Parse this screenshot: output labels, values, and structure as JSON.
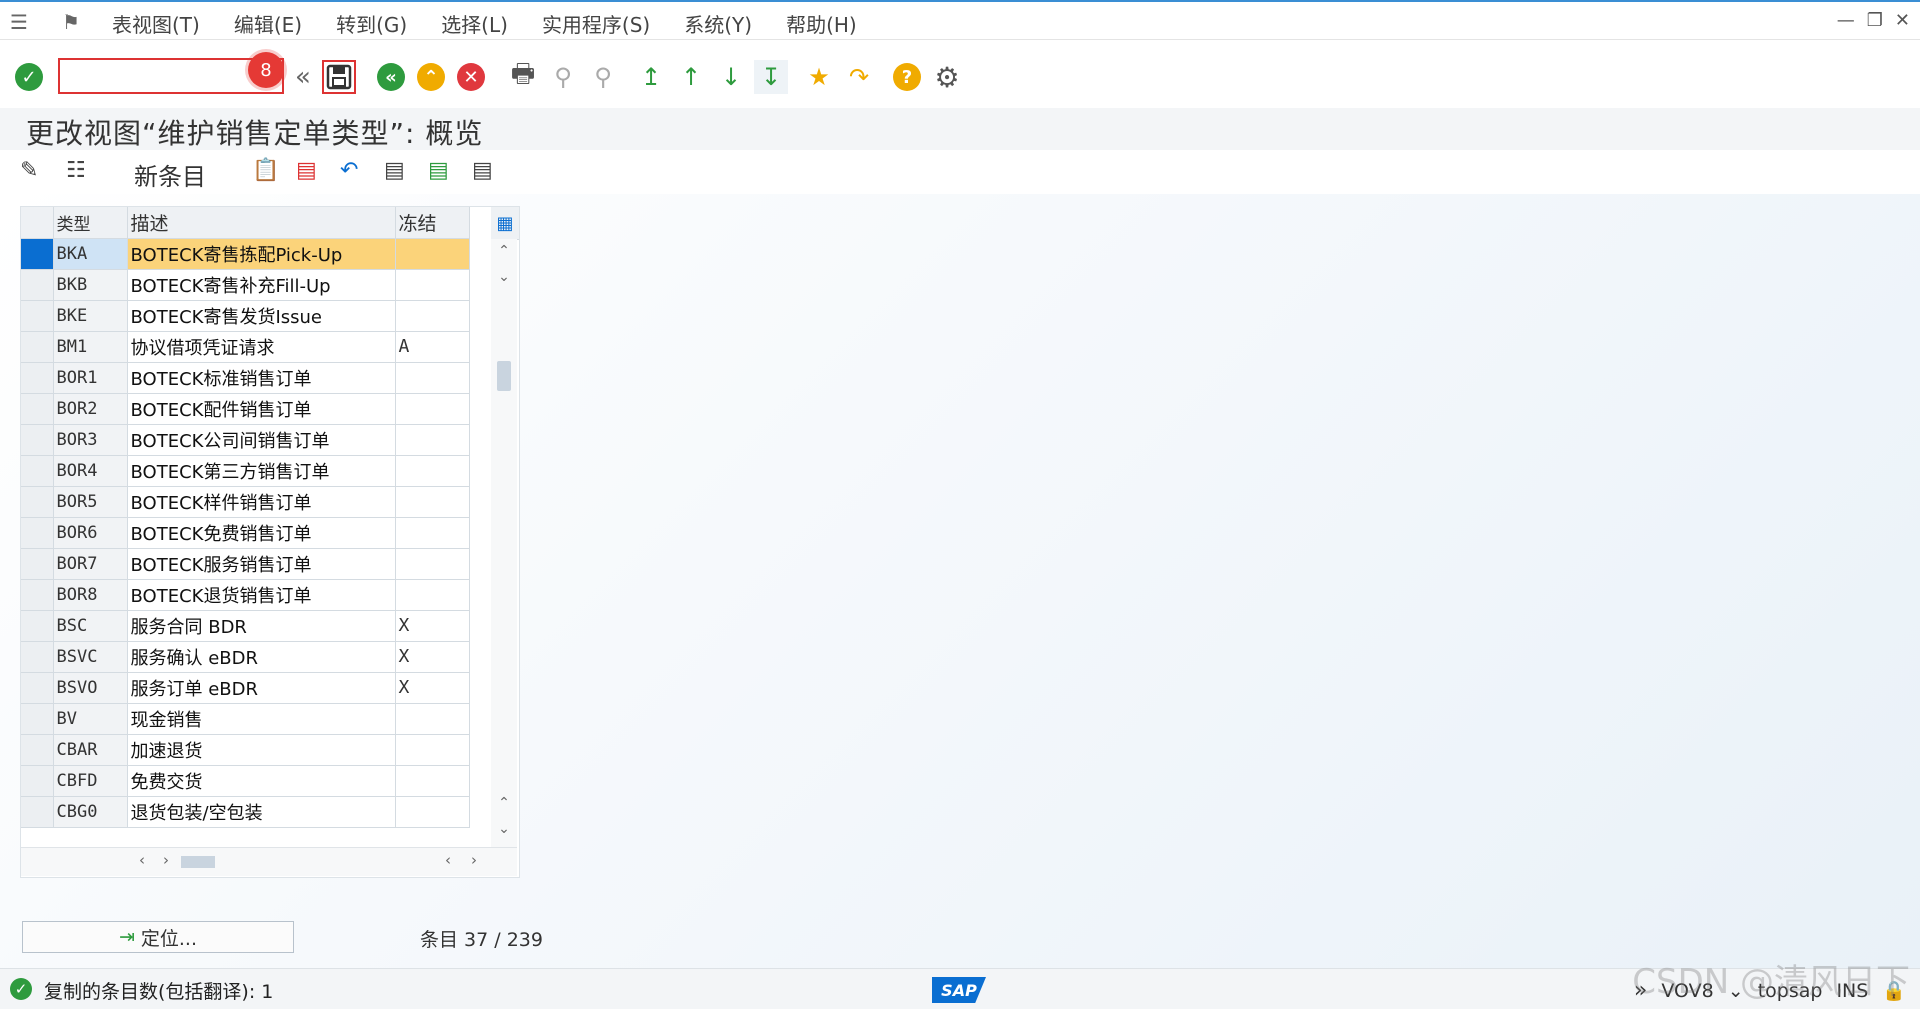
{
  "menubar": {
    "items": [
      "表视图(T)",
      "编辑(E)",
      "转到(G)",
      "选择(L)",
      "实用程序(S)",
      "系统(Y)",
      "帮助(H)"
    ]
  },
  "toolbar": {
    "command_value": "",
    "badge": "8"
  },
  "page": {
    "title": "更改视图“维护销售定单类型”: 概览"
  },
  "app_toolbar": {
    "new_entries_label": "新条目"
  },
  "table": {
    "headers": [
      "类型",
      "描述",
      "冻结"
    ],
    "rows": [
      {
        "type": "BKA",
        "desc": "BOTECK寄售拣配Pick-Up",
        "frozen": ""
      },
      {
        "type": "BKB",
        "desc": "BOTECK寄售补充Fill-Up",
        "frozen": ""
      },
      {
        "type": "BKE",
        "desc": "BOTECK寄售发货Issue",
        "frozen": ""
      },
      {
        "type": "BM1",
        "desc": "协议借项凭证请求",
        "frozen": "A"
      },
      {
        "type": "BOR1",
        "desc": "BOTECK标准销售订单",
        "frozen": ""
      },
      {
        "type": "BOR2",
        "desc": "BOTECK配件销售订单",
        "frozen": ""
      },
      {
        "type": "BOR3",
        "desc": "BOTECK公司间销售订单",
        "frozen": ""
      },
      {
        "type": "BOR4",
        "desc": "BOTECK第三方销售订单",
        "frozen": ""
      },
      {
        "type": "BOR5",
        "desc": "BOTECK样件销售订单",
        "frozen": ""
      },
      {
        "type": "BOR6",
        "desc": "BOTECK免费销售订单",
        "frozen": ""
      },
      {
        "type": "BOR7",
        "desc": "BOTECK服务销售订单",
        "frozen": ""
      },
      {
        "type": "BOR8",
        "desc": "BOTECK退货销售订单",
        "frozen": ""
      },
      {
        "type": "BSC",
        "desc": "服务合同 BDR",
        "frozen": "X"
      },
      {
        "type": "BSVC",
        "desc": "服务确认 eBDR",
        "frozen": "X"
      },
      {
        "type": "BSVO",
        "desc": "服务订单 eBDR",
        "frozen": "X"
      },
      {
        "type": "BV",
        "desc": "现金销售",
        "frozen": ""
      },
      {
        "type": "CBAR",
        "desc": "加速退货",
        "frozen": ""
      },
      {
        "type": "CBFD",
        "desc": "免费交货",
        "frozen": ""
      },
      {
        "type": "CBG0",
        "desc": "退货包装/空包装",
        "frozen": ""
      }
    ]
  },
  "footer": {
    "position_button": "定位...",
    "entries_text": "条目 37 / 239"
  },
  "statusbar": {
    "message": "复制的条目数(包括翻译): 1",
    "sap_logo": "SAP",
    "transaction": "VOV8",
    "user": "topsap",
    "mode": "INS"
  },
  "watermark": "CSDN @清风日下",
  "colors": {
    "accent": "#0a6ed1",
    "highlight_row": "#fbd37a",
    "ok_green": "#2e9b3e",
    "cancel_red": "#e0383e",
    "back_green": "#2e9b3e",
    "exit_orange": "#f0ab00"
  }
}
